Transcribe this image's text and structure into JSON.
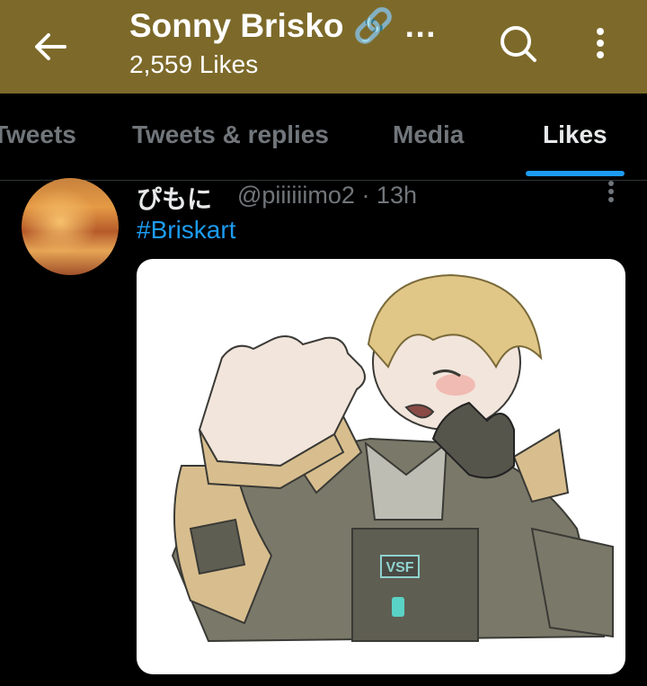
{
  "header": {
    "title": "Sonny Brisko 🔗 …",
    "subtitle": "2,559 Likes",
    "bg_color": "#7d6a2a",
    "back_icon": "arrow-left-icon",
    "search_icon": "search-icon",
    "more_icon": "more-vertical-icon"
  },
  "tabs": [
    {
      "label": "Tweets"
    },
    {
      "label": "Tweets & replies"
    },
    {
      "label": "Media"
    },
    {
      "label": "Likes",
      "active": true
    }
  ],
  "tweet": {
    "author": "ぴもに",
    "handle_time": "@piiiiiimo2 · 13h",
    "text": "#Briskart",
    "media_badge": "VSF",
    "link_color": "#1d9bf0"
  }
}
